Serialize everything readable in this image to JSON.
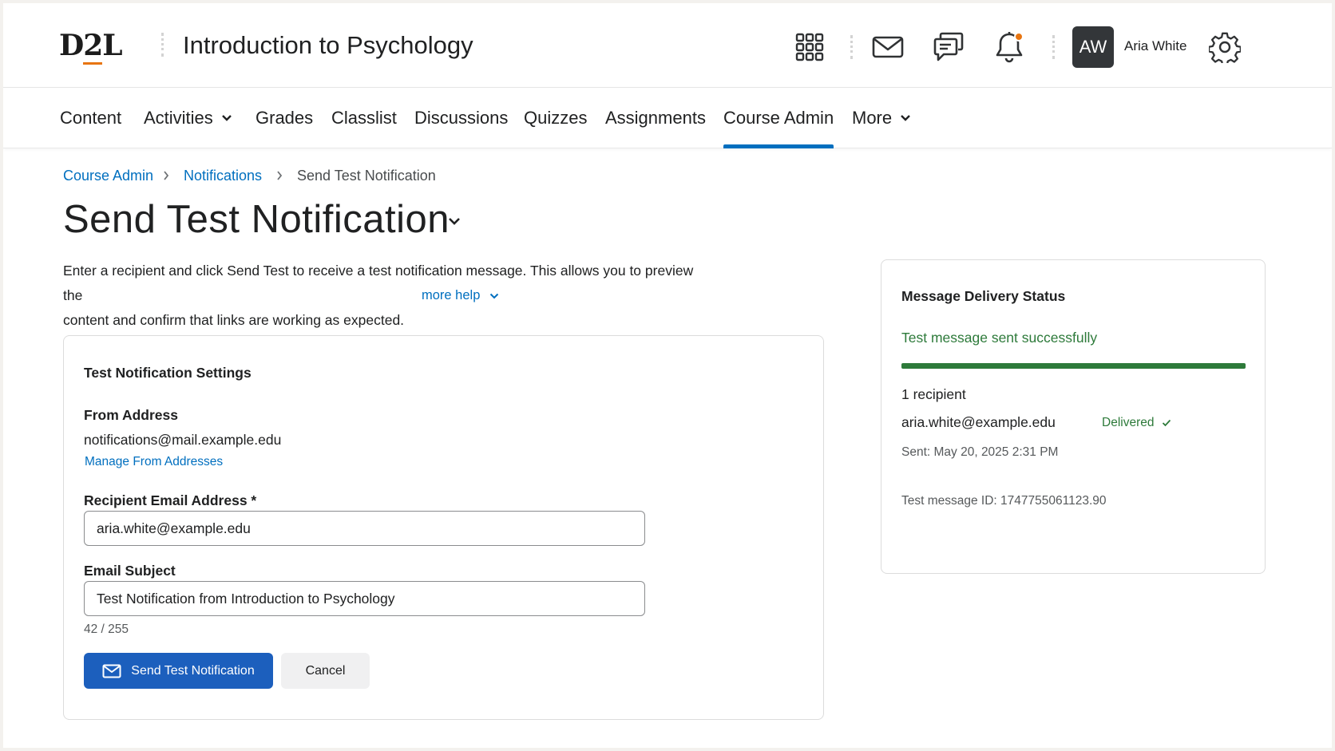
{
  "header": {
    "logo_prefix": "D",
    "logo_accent": "2",
    "logo_suffix": "L",
    "course_title": "Introduction to Psychology",
    "avatar_initials": "AW",
    "user_name": "Aria White",
    "icons": [
      "apps-grid-icon",
      "mail-icon",
      "chat-icon",
      "bell-icon",
      "gear-icon"
    ],
    "notification_dot_color": "#e87511"
  },
  "nav": {
    "items": [
      {
        "label": "Content"
      },
      {
        "label": "Activities",
        "has_dropdown": true
      },
      {
        "label": "Grades"
      },
      {
        "label": "Classlist"
      },
      {
        "label": "Discussions"
      },
      {
        "label": "Quizzes"
      },
      {
        "label": "Assignments"
      },
      {
        "label": "Course Admin",
        "active": true
      },
      {
        "label": "More",
        "has_dropdown": true
      }
    ],
    "active_color": "#006fbf"
  },
  "breadcrumb": {
    "items": [
      "Course Admin",
      "Notifications",
      "Send Test Notification"
    ]
  },
  "page": {
    "title": "Send Test Notification",
    "intro_line1": "Enter a recipient and click Send Test to receive a test notification message. This allows you to preview the",
    "intro_line2": "content and confirm that links are working as expected.",
    "more_help": "more help"
  },
  "settings": {
    "heading": "Test Notification Settings",
    "from_label": "From Address",
    "from_value": "notifications@mail.example.edu",
    "manage_link": "Manage From Addresses",
    "recipient_label": "Recipient Email Address *",
    "recipient_value": "aria.white@example.edu",
    "subject_label": "Email Subject",
    "subject_value": "Test Notification from Introduction to Psychology",
    "char_counter": "42 / 255",
    "send_button": "Send Test Notification",
    "cancel_button": "Cancel",
    "primary_color": "#1c5fbd"
  },
  "status": {
    "heading": "Message Delivery Status",
    "result": "Test message sent successfully",
    "progress": 1.0,
    "progress_color": "#2d7a3a",
    "recipient_count": "1 recipient",
    "recipient_email": "aria.white@example.edu",
    "delivery_state": "Delivered",
    "sent_at": "Sent: May 20, 2025 2:31 PM",
    "message_id": "Test message ID: 1747755061123.90"
  }
}
